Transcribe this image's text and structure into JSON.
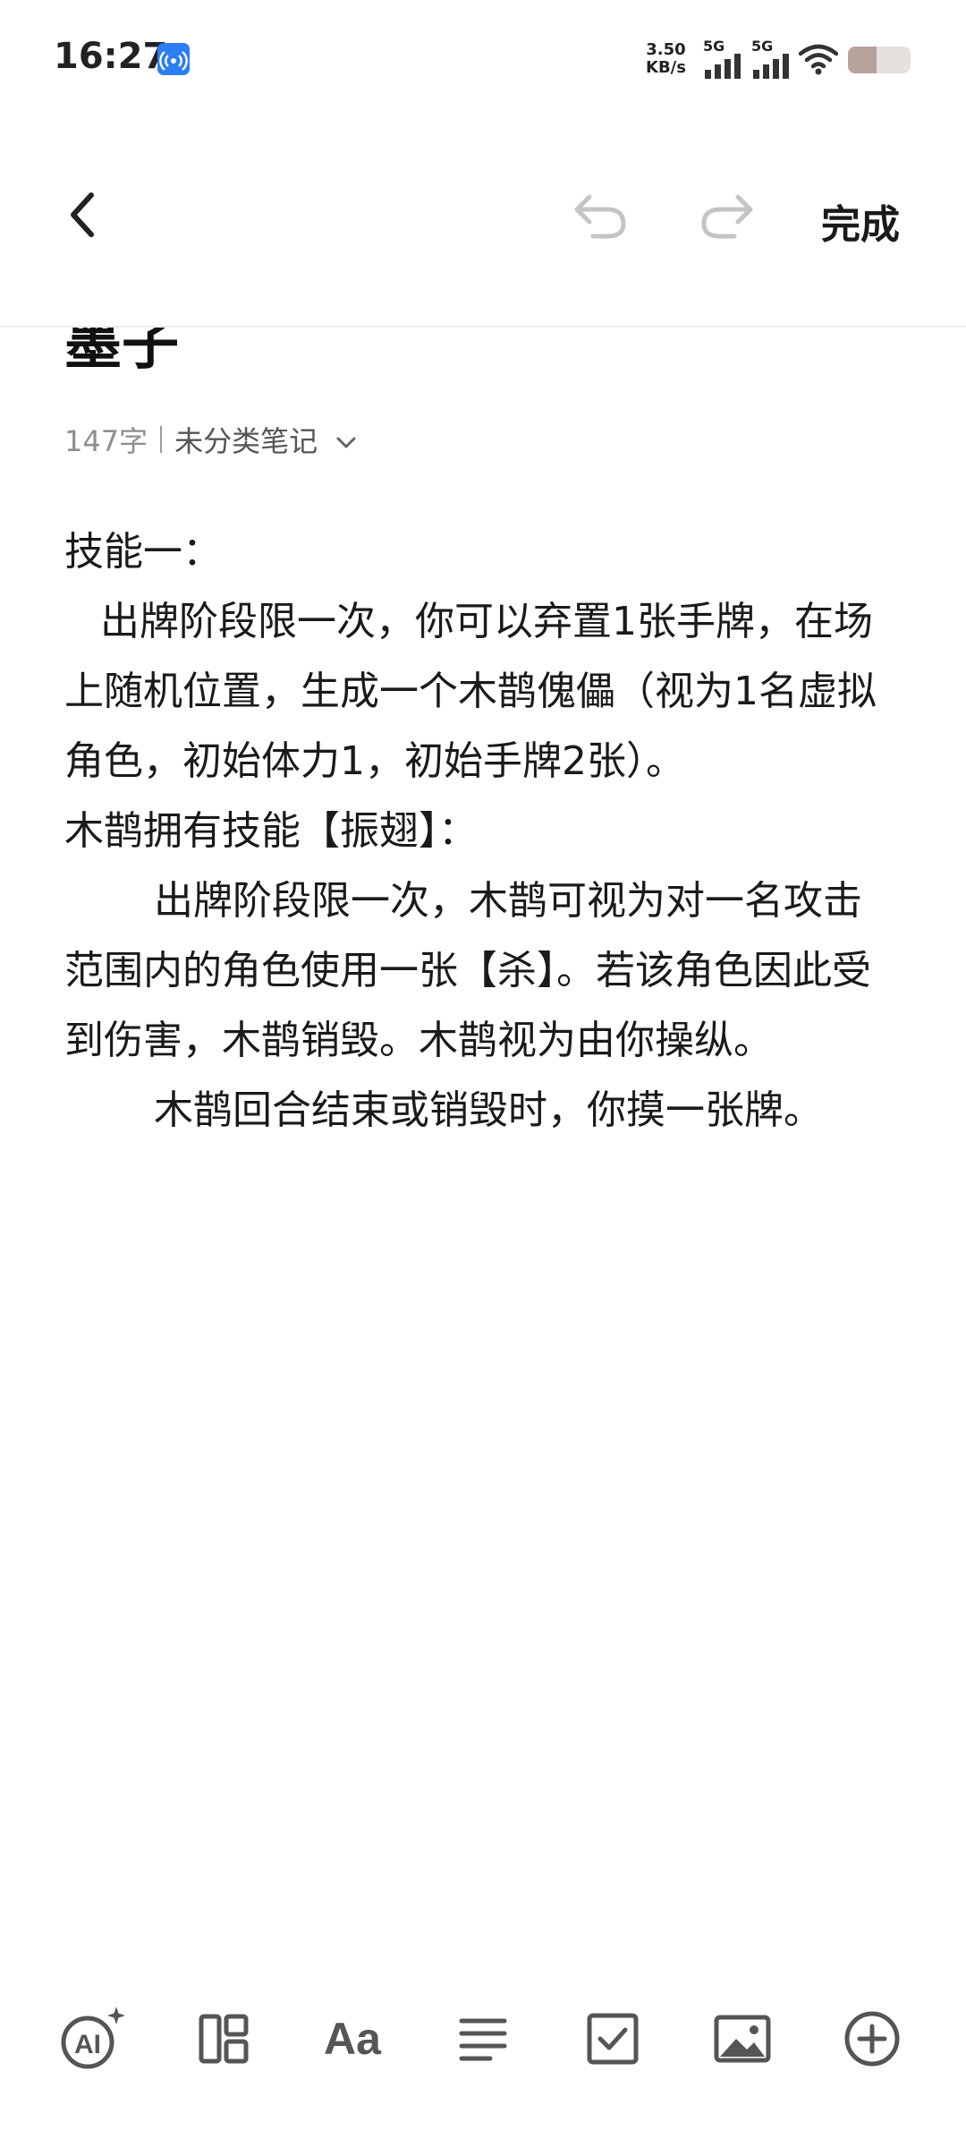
{
  "status_bar": {
    "time": "16:27",
    "net_speed_value": "3.50",
    "net_speed_unit": "KB/s",
    "sim1_label": "5G",
    "sim2_label": "5G",
    "battery_level": 0.45
  },
  "toolbar": {
    "done_label": "完成"
  },
  "note": {
    "title": "墨子",
    "word_count": "147字",
    "category": "未分类笔记",
    "paragraphs": [
      "技能一：",
      "出牌阶段限一次，你可以弃置1张手牌，在场上随机位置，生成一个木鹊傀儡（视为1名虚拟角色，初始体力1，初始手牌2张）。",
      "木鹊拥有技能【振翅】：",
      "出牌阶段限一次，木鹊可视为对一名攻击范围内的角色使用一张【杀】。若该角色因此受到伤害，木鹊销毁。木鹊视为由你操纵。",
      "木鹊回合结束或销毁时，你摸一张牌。"
    ]
  },
  "bottom_bar": {
    "ai_label": "AI",
    "font_label": "Aa"
  },
  "colors": {
    "accent_blue": "#2d7df6",
    "icon_gray": "#555555",
    "text": "#1a1a1a",
    "meta_gray": "#8e8e8e"
  }
}
